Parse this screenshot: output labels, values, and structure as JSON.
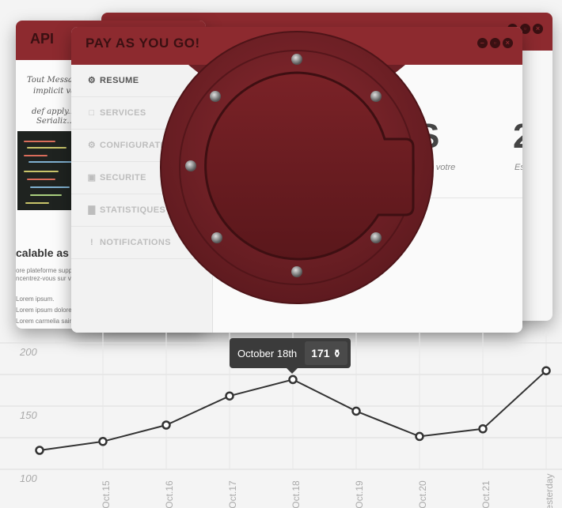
{
  "windows": {
    "back": {},
    "api": {
      "title": "API",
      "handwriting": [
        "Tout Messa...",
        "implicit val ...",
        "def apply...",
        "Serializ..."
      ],
      "heading": "calable as h",
      "paragraph": [
        "ore plateforme supp...",
        "ncentrez-vous sur v..."
      ],
      "list": [
        "Lorem ipsum.",
        "Lorem ipsum dolores...",
        "Lorem carmelia saine..."
      ]
    },
    "main": {
      "title": "PAY AS YOU GO!",
      "controls": [
        "minimize",
        "maximize",
        "close"
      ],
      "nav": [
        {
          "label": "RESUME",
          "icon": "gear-icon",
          "glyph": "⚙",
          "active": true
        },
        {
          "label": "SERVICES",
          "icon": "square-icon",
          "glyph": "□",
          "active": false
        },
        {
          "label": "CONFIGURATION",
          "icon": "gear-icon",
          "glyph": "⚙",
          "active": false
        },
        {
          "label": "SECURITE",
          "icon": "lock-icon",
          "glyph": "▣",
          "active": false
        },
        {
          "label": "STATISTIQUES",
          "icon": "bar-chart-icon",
          "glyph": "▇",
          "active": false
        },
        {
          "label": "NOTIFICATIONS",
          "icon": "exclamation-icon",
          "glyph": "!",
          "active": false
        }
      ],
      "stats": [
        {
          "number": "S",
          "text": "ans votre"
        },
        {
          "number": "2",
          "text": "Es"
        }
      ]
    }
  },
  "tooltip": {
    "date": "October 18th",
    "value": "171"
  },
  "colors": {
    "brand": "#8d2a2f",
    "hatch": "#6b1f25",
    "line": "#333333",
    "grid": "#dcdcdc"
  },
  "chart_data": {
    "type": "line",
    "categories": [
      "",
      "Oct.15",
      "Oct.16",
      "Oct.17",
      "Oct.18",
      "Oct.19",
      "Oct.20",
      "Oct.21",
      "Yesterday"
    ],
    "values": [
      115,
      122,
      135,
      158,
      171,
      146,
      126,
      132,
      178
    ],
    "yticks": [
      100,
      150,
      200
    ],
    "ylim": [
      100,
      200
    ]
  }
}
